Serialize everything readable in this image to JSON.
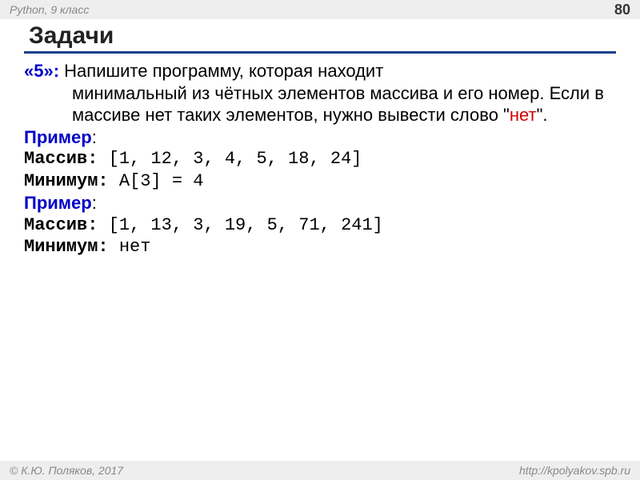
{
  "header": {
    "subject": "Python",
    "grade": "9 класс",
    "page_number": "80"
  },
  "title": "Задачи",
  "task": {
    "grade_label": "«5»:",
    "text_before_red": " Напишите программу, которая находит минимальный из чётных элементов массива и его номер. Если в массиве нет таких элементов, нужно вывести слово \"",
    "red_word": "нет",
    "text_after_red": "\"."
  },
  "examples": [
    {
      "label": "Пример",
      "array_label": "Массив:",
      "array_value": " [1, 12, 3, 4, 5, 18, 24]",
      "min_label": "Минимум:",
      "min_value": " A[3] = 4"
    },
    {
      "label": "Пример",
      "array_label": "Массив:",
      "array_value": " [1, 13, 3, 19, 5, 71, 241]",
      "min_label": "Минимум:",
      "min_value": " нет"
    }
  ],
  "footer": {
    "copyright": "© К.Ю. Поляков, 2017",
    "url": "http://kpolyakov.spb.ru"
  }
}
